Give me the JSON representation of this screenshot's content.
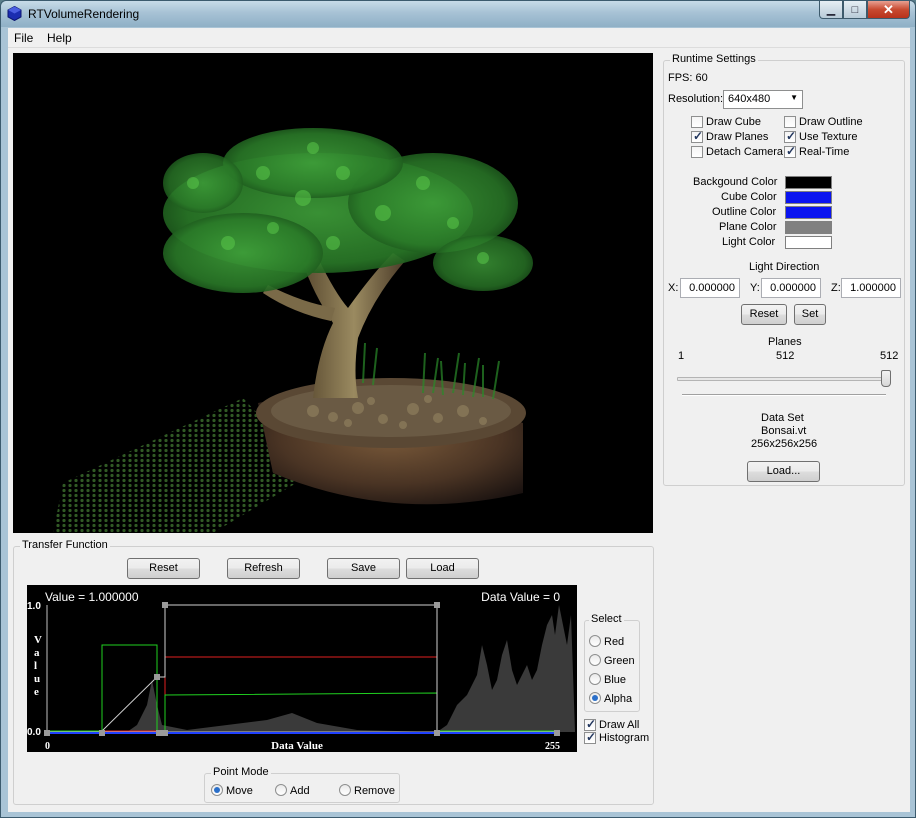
{
  "window": {
    "title": "RTVolumeRendering",
    "minimize_glyph": "▁",
    "maximize_glyph": "□",
    "close_glyph": "✕"
  },
  "menu": [
    "File",
    "Help"
  ],
  "runtime": {
    "title": "Runtime Settings",
    "fps": "FPS: 60",
    "resolution_label": "Resolution:",
    "resolution_value": "640x480",
    "checkboxes": [
      {
        "label": "Draw Cube",
        "checked": false
      },
      {
        "label": "Draw Outline",
        "checked": false
      },
      {
        "label": "Draw Planes",
        "checked": true
      },
      {
        "label": "Use Texture",
        "checked": true
      },
      {
        "label": "Detach Camera",
        "checked": false
      },
      {
        "label": "Real-Time",
        "checked": true
      }
    ],
    "colors": [
      {
        "label": "Backgound Color",
        "color": "#000000"
      },
      {
        "label": "Cube Color",
        "color": "#0a14f0"
      },
      {
        "label": "Outline Color",
        "color": "#0a14f0"
      },
      {
        "label": "Plane Color",
        "color": "#808080"
      },
      {
        "label": "Light Color",
        "color": "#ffffff"
      }
    ],
    "light_direction": {
      "title": "Light Direction",
      "x_label": "X:",
      "x": "0.000000",
      "y_label": "Y:",
      "y": "0.000000",
      "z_label": "Z:",
      "z": "1.000000",
      "reset": "Reset",
      "set": "Set"
    },
    "planes": {
      "title": "Planes",
      "min": "1",
      "current": "512",
      "max": "512",
      "fraction": 1.0
    },
    "dataset": {
      "title": "Data Set",
      "name": "Bonsai.vt",
      "dims": "256x256x256",
      "load": "Load..."
    }
  },
  "transfer": {
    "title": "Transfer Function",
    "buttons": [
      "Reset",
      "Refresh",
      "Save",
      "Load"
    ],
    "value_text": "Value = 1.000000",
    "data_value_text": "Data Value = 0",
    "y_top": "1.0",
    "y_bottom": "0.0",
    "y_axis_label": "Value",
    "x_axis_label": "Data Value",
    "x_min": "0",
    "x_max": "255",
    "select": {
      "title": "Select",
      "options": [
        {
          "label": "Red",
          "checked": false
        },
        {
          "label": "Green",
          "checked": false
        },
        {
          "label": "Blue",
          "checked": false
        },
        {
          "label": "Alpha",
          "checked": true
        }
      ]
    },
    "draw_all": {
      "label": "Draw All",
      "checked": true
    },
    "histogram": {
      "label": "Histogram",
      "checked": true
    },
    "point_mode": {
      "title": "Point Mode",
      "options": [
        {
          "label": "Move",
          "checked": true
        },
        {
          "label": "Add",
          "checked": false
        },
        {
          "label": "Remove",
          "checked": false
        }
      ]
    },
    "curves": {
      "red_color": "#e02020",
      "green_color": "#20d020",
      "blue_color": "#2040ff",
      "alpha_color": "#d0d0d0"
    }
  }
}
